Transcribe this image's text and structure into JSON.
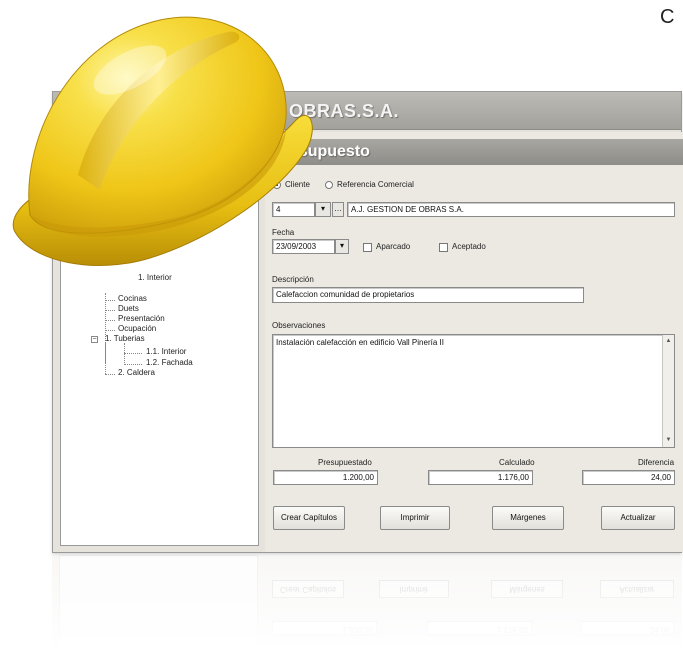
{
  "corner_text": "C",
  "app": {
    "company": "OBRAS.S.A.",
    "tree": [
      {
        "label": "1. Interior",
        "level": "child"
      },
      {
        "label": "Cocinas",
        "level": "sibling"
      },
      {
        "label": "Duets",
        "level": "sibling"
      },
      {
        "label": "Presentación",
        "level": "sibling"
      },
      {
        "label": "Ocupación",
        "level": "sibling"
      },
      {
        "label": "1. Tuberias",
        "level": "parent"
      },
      {
        "label": "1.1. Interior",
        "level": "child"
      },
      {
        "label": "1.2. Fachada",
        "level": "child"
      },
      {
        "label": "2. Caldera",
        "level": "sibling"
      }
    ],
    "form": {
      "section_title": "Presupuesto",
      "radio_cliente": "Cliente",
      "radio_referencia": "Referencia Comercial",
      "client_code": "4",
      "client_name": "A.J. GESTION DE OBRAS S.A.",
      "fecha_label": "Fecha",
      "fecha_value": "23/09/2003",
      "aparcado_label": "Aparcado",
      "aceptado_label": "Aceptado",
      "descripcion_label": "Descripción",
      "descripcion_value": "Calefaccion comunidad de propietarios",
      "observaciones_label": "Observaciones",
      "observaciones_value": "Instalación calefacción en edificio Vall Pinería II",
      "presupuestado_label": "Presupuestado",
      "presupuestado_value": "1.200,00",
      "calculado_label": "Calculado",
      "calculado_value": "1.176,00",
      "diferencia_label": "Diferencia",
      "diferencia_value": "24,00"
    },
    "buttons": {
      "crear": "Crear Capítulos",
      "imprimir": "Imprimir",
      "margenes": "Márgenes",
      "actualizar": "Actualizar"
    }
  },
  "colors": {
    "helmet": "#f2cf1c",
    "header_bar": "#a3a19b",
    "window_bg": "#e6e3dc"
  },
  "icons": [
    "hard-hat-icon",
    "dropdown-arrow-icon",
    "ellipsis-icon",
    "scroll-up-icon",
    "scroll-down-icon"
  ]
}
